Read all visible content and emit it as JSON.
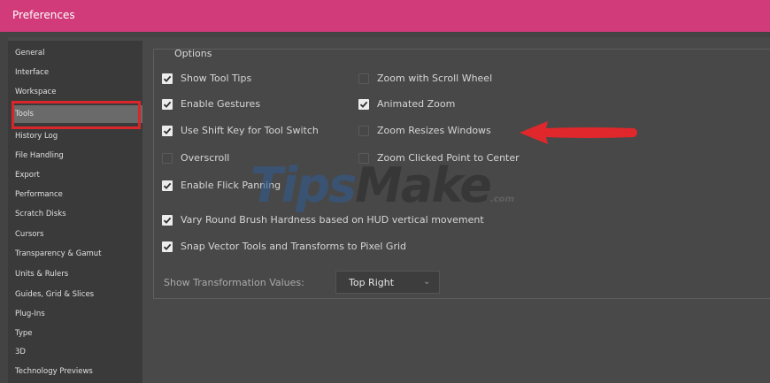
{
  "window": {
    "title": "Preferences"
  },
  "sidebar": {
    "items": [
      {
        "label": "General"
      },
      {
        "label": "Interface"
      },
      {
        "label": "Workspace"
      },
      {
        "label": "Tools",
        "selected": true
      },
      {
        "label": "History Log"
      },
      {
        "label": "File Handling"
      },
      {
        "label": "Export"
      },
      {
        "label": "Performance"
      },
      {
        "label": "Scratch Disks"
      },
      {
        "label": "Cursors"
      },
      {
        "label": "Transparency & Gamut"
      },
      {
        "label": "Units & Rulers"
      },
      {
        "label": "Guides, Grid & Slices"
      },
      {
        "label": "Plug-Ins"
      },
      {
        "label": "Type"
      },
      {
        "label": "3D"
      },
      {
        "label": "Technology Previews"
      }
    ]
  },
  "options": {
    "heading": "Options",
    "items": [
      {
        "label": "Show Tool Tips",
        "checked": true
      },
      {
        "label": "Zoom with Scroll Wheel",
        "checked": false
      },
      {
        "label": "Enable Gestures",
        "checked": true
      },
      {
        "label": "Animated Zoom",
        "checked": true
      },
      {
        "label": "Use Shift Key for Tool Switch",
        "checked": true
      },
      {
        "label": "Zoom Resizes Windows",
        "checked": false
      },
      {
        "label": "Overscroll",
        "checked": false
      },
      {
        "label": "Zoom Clicked Point to Center",
        "checked": false
      },
      {
        "label": "Enable Flick Panning",
        "checked": true
      },
      {
        "label": "Vary Round Brush Hardness based on HUD vertical movement",
        "checked": true
      },
      {
        "label": "Snap Vector Tools and Transforms to Pixel Grid",
        "checked": true
      }
    ],
    "transformation_values": {
      "label": "Show Transformation Values:",
      "value": "Top Right"
    }
  },
  "watermark": {
    "part1": "Tips",
    "part2": "Make",
    "suffix": ".com"
  },
  "colors": {
    "titlebar": "#d23b7a",
    "highlight_box": "#d9262b",
    "arrow": "#e0272b"
  },
  "icons": {
    "select_chevron": "chevron-down-icon",
    "annotation": "red-arrow-left-icon"
  }
}
